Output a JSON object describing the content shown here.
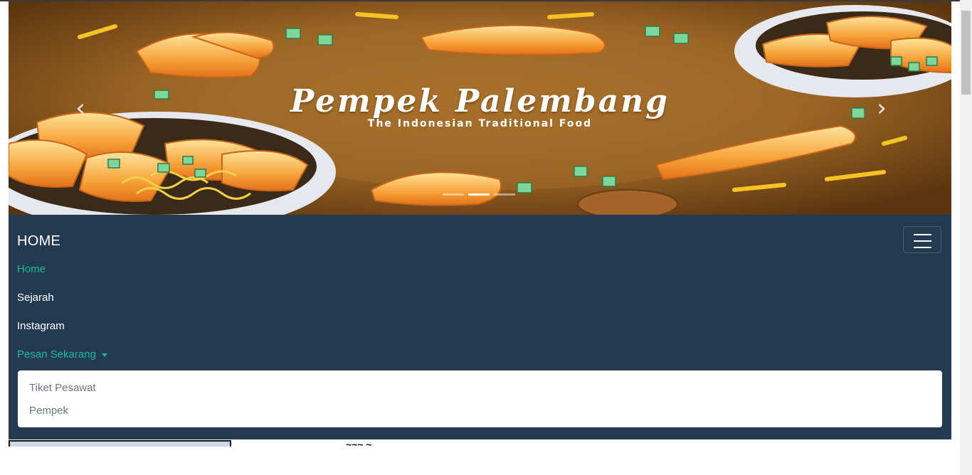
{
  "carousel": {
    "title": "Pempek Palembang",
    "subtitle": "The Indonesian Traditional Food",
    "prev_icon": "‹",
    "next_icon": "›",
    "slide_count": 3,
    "active_slide": 2
  },
  "navbar": {
    "brand": "HOME",
    "toggler_icon": "hamburger-icon",
    "links": [
      "Home",
      "Sejarah",
      "Instagram",
      "Pesan Sekarang"
    ],
    "dropdown_items": [
      "Tiket Pesawat",
      "Pempek"
    ]
  },
  "below": {
    "partial_heading": "~~~ ~"
  },
  "colors": {
    "navbar_bg": "#243a50",
    "accent": "#1abc9c",
    "banner_bg": "#7a4a12"
  }
}
